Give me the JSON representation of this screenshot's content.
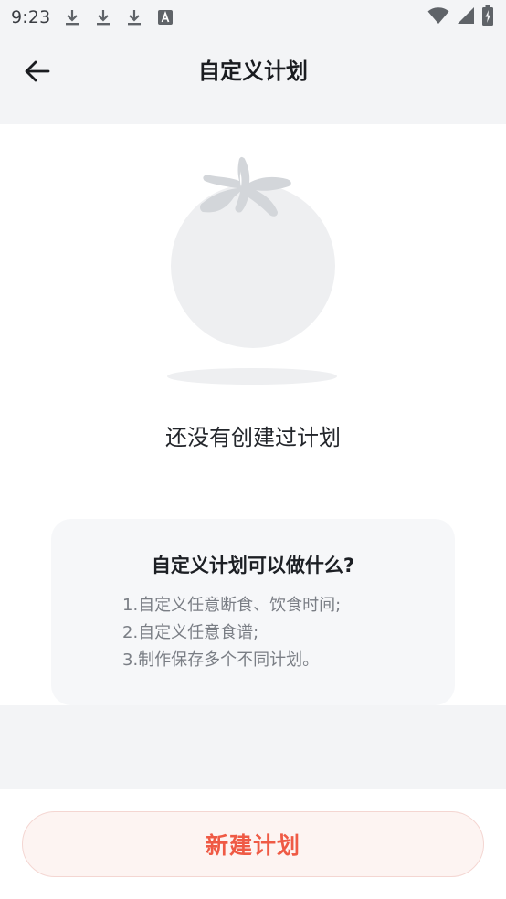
{
  "status_bar": {
    "time": "9:23",
    "left_icons": [
      "download-icon",
      "download-icon",
      "download-icon",
      "keyboard-a-icon"
    ],
    "right_icons": [
      "wifi-icon",
      "signal-icon",
      "battery-charging-icon"
    ]
  },
  "header": {
    "title": "自定义计划",
    "back_icon": "arrow-left-icon"
  },
  "empty_state": {
    "illustration": "tomato-icon",
    "message": "还没有创建过计划"
  },
  "info": {
    "title": "自定义计划可以做什么?",
    "items": [
      "1.自定义任意断食、饮食时间;",
      "2.自定义任意食谱;",
      "3.制作保存多个不同计划。"
    ]
  },
  "footer": {
    "create_label": "新建计划"
  },
  "colors": {
    "accent": "#ef5a45",
    "button_bg": "#fdf4f2",
    "page_bg": "#f3f4f6",
    "card_bg": "#ffffff",
    "info_bg": "#f6f7f9"
  }
}
